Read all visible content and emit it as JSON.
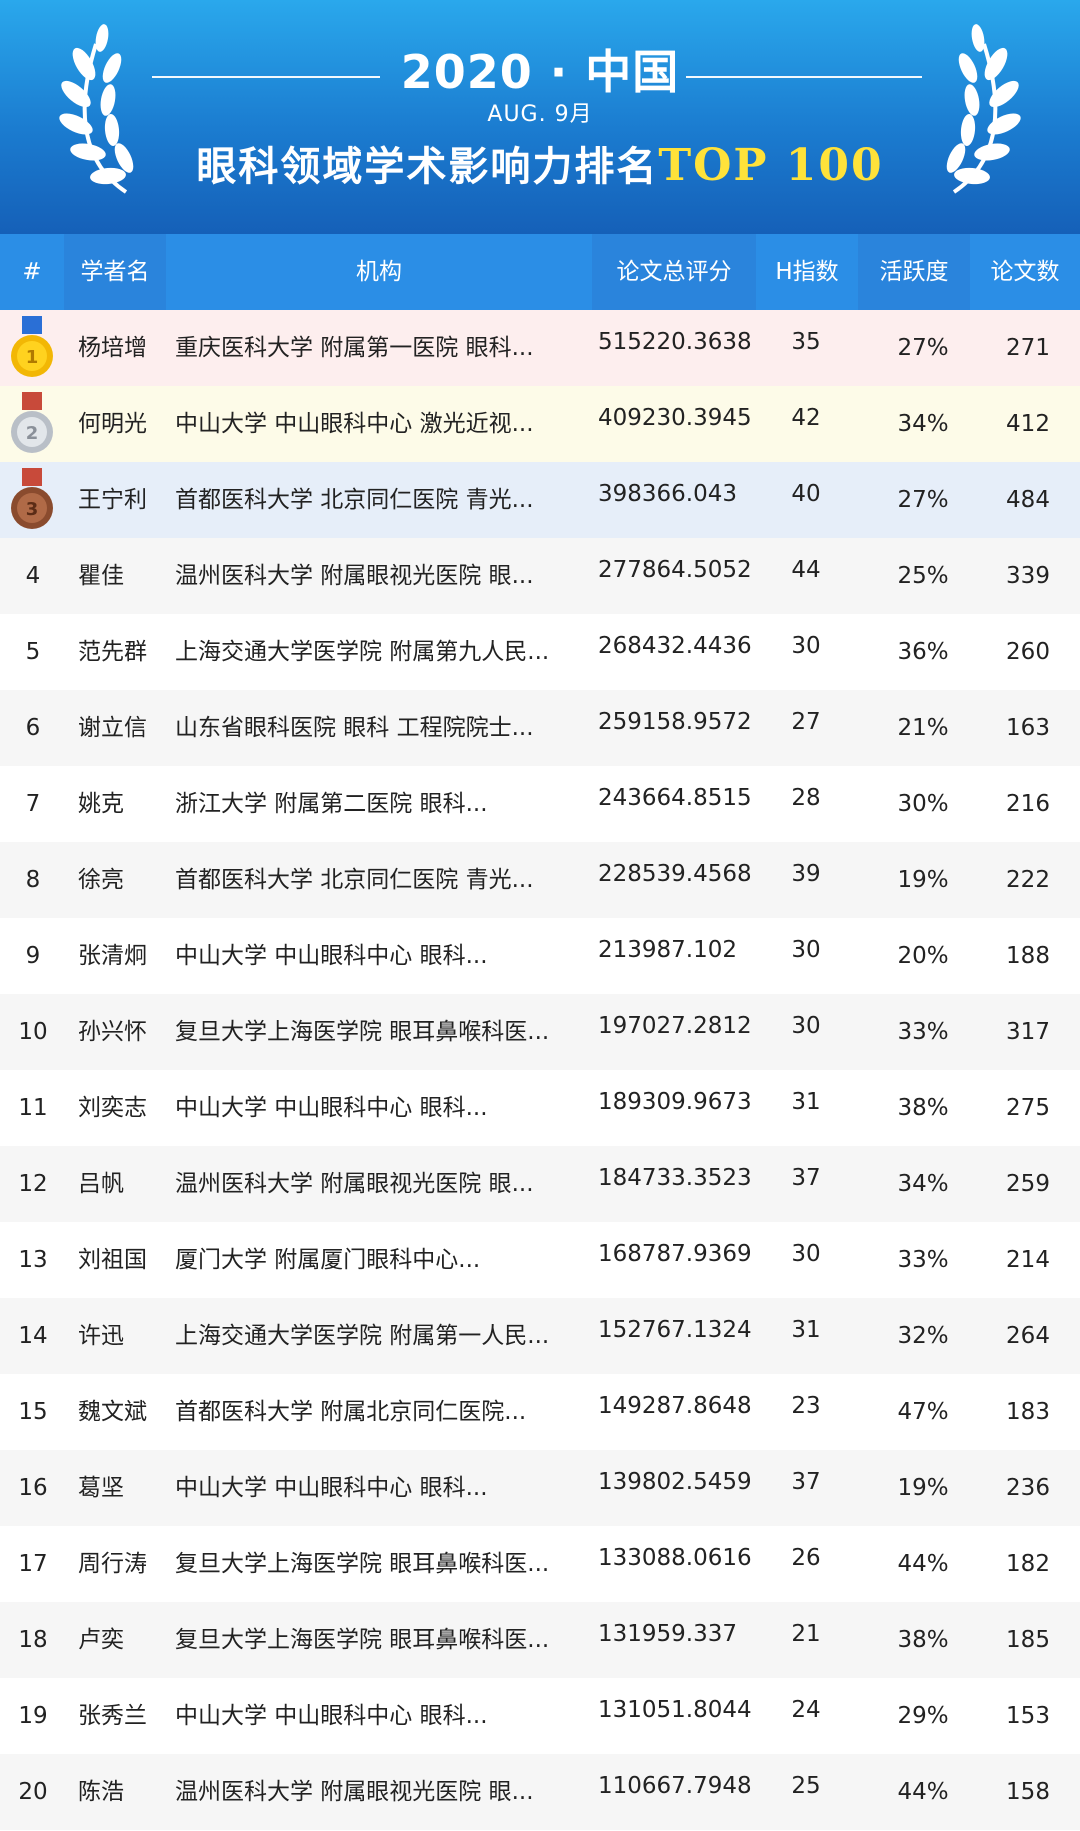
{
  "header": {
    "title": "2020 · 中国",
    "subtitle": "AUG.  9月",
    "headline": "眼科领域学术影响力排名",
    "headline_highlight": "TOP 100"
  },
  "columns": [
    "#",
    "学者名",
    "机构",
    "论文总评分",
    "H指数",
    "活跃度",
    "论文数"
  ],
  "colors": {
    "header_top": "#2aa8ec",
    "header_bottom": "#1560b8",
    "table_head": "#2b8ee6",
    "highlight_text": "#ffe23a",
    "gold_row": "#fdeeee",
    "silver_row": "#fdfbe8",
    "bronze_row": "#e6eef9"
  },
  "medal_icons": [
    "gold-medal-icon",
    "silver-medal-icon",
    "bronze-medal-icon"
  ],
  "rows": [
    {
      "rank": "1",
      "name": "杨培增",
      "org": "重庆医科大学 附属第一医院 眼科...",
      "score": "515220.3638",
      "h": "35",
      "activity": "27%",
      "papers": "271"
    },
    {
      "rank": "2",
      "name": "何明光",
      "org": "中山大学 中山眼科中心 激光近视...",
      "score": "409230.3945",
      "h": "42",
      "activity": "34%",
      "papers": "412"
    },
    {
      "rank": "3",
      "name": "王宁利",
      "org": "首都医科大学 北京同仁医院 青光...",
      "score": "398366.043",
      "h": "40",
      "activity": "27%",
      "papers": "484"
    },
    {
      "rank": "4",
      "name": "瞿佳",
      "org": "温州医科大学 附属眼视光医院 眼...",
      "score": "277864.5052",
      "h": "44",
      "activity": "25%",
      "papers": "339"
    },
    {
      "rank": "5",
      "name": "范先群",
      "org": "上海交通大学医学院 附属第九人民...",
      "score": "268432.4436",
      "h": "30",
      "activity": "36%",
      "papers": "260"
    },
    {
      "rank": "6",
      "name": "谢立信",
      "org": "山东省眼科医院 眼科 工程院院士...",
      "score": "259158.9572",
      "h": "27",
      "activity": "21%",
      "papers": "163"
    },
    {
      "rank": "7",
      "name": "姚克",
      "org": "浙江大学 附属第二医院 眼科...",
      "score": "243664.8515",
      "h": "28",
      "activity": "30%",
      "papers": "216"
    },
    {
      "rank": "8",
      "name": "徐亮",
      "org": "首都医科大学 北京同仁医院 青光...",
      "score": "228539.4568",
      "h": "39",
      "activity": "19%",
      "papers": "222"
    },
    {
      "rank": "9",
      "name": "张清炯",
      "org": "中山大学 中山眼科中心 眼科...",
      "score": "213987.102",
      "h": "30",
      "activity": "20%",
      "papers": "188"
    },
    {
      "rank": "10",
      "name": "孙兴怀",
      "org": "复旦大学上海医学院 眼耳鼻喉科医...",
      "score": "197027.2812",
      "h": "30",
      "activity": "33%",
      "papers": "317"
    },
    {
      "rank": "11",
      "name": "刘奕志",
      "org": "中山大学 中山眼科中心 眼科...",
      "score": "189309.9673",
      "h": "31",
      "activity": "38%",
      "papers": "275"
    },
    {
      "rank": "12",
      "name": "吕帆",
      "org": "温州医科大学 附属眼视光医院 眼...",
      "score": "184733.3523",
      "h": "37",
      "activity": "34%",
      "papers": "259"
    },
    {
      "rank": "13",
      "name": "刘祖国",
      "org": "厦门大学 附属厦门眼科中心...",
      "score": "168787.9369",
      "h": "30",
      "activity": "33%",
      "papers": "214"
    },
    {
      "rank": "14",
      "name": "许迅",
      "org": "上海交通大学医学院 附属第一人民...",
      "score": "152767.1324",
      "h": "31",
      "activity": "32%",
      "papers": "264"
    },
    {
      "rank": "15",
      "name": "魏文斌",
      "org": "首都医科大学 附属北京同仁医院...",
      "score": "149287.8648",
      "h": "23",
      "activity": "47%",
      "papers": "183"
    },
    {
      "rank": "16",
      "name": "葛坚",
      "org": "中山大学 中山眼科中心 眼科...",
      "score": "139802.5459",
      "h": "37",
      "activity": "19%",
      "papers": "236"
    },
    {
      "rank": "17",
      "name": "周行涛",
      "org": "复旦大学上海医学院 眼耳鼻喉科医...",
      "score": "133088.0616",
      "h": "26",
      "activity": "44%",
      "papers": "182"
    },
    {
      "rank": "18",
      "name": "卢奕",
      "org": "复旦大学上海医学院 眼耳鼻喉科医...",
      "score": "131959.337",
      "h": "21",
      "activity": "38%",
      "papers": "185"
    },
    {
      "rank": "19",
      "name": "张秀兰",
      "org": "中山大学 中山眼科中心 眼科...",
      "score": "131051.8044",
      "h": "24",
      "activity": "29%",
      "papers": "153"
    },
    {
      "rank": "20",
      "name": "陈浩",
      "org": "温州医科大学 附属眼视光医院 眼...",
      "score": "110667.7948",
      "h": "25",
      "activity": "44%",
      "papers": "158"
    }
  ]
}
